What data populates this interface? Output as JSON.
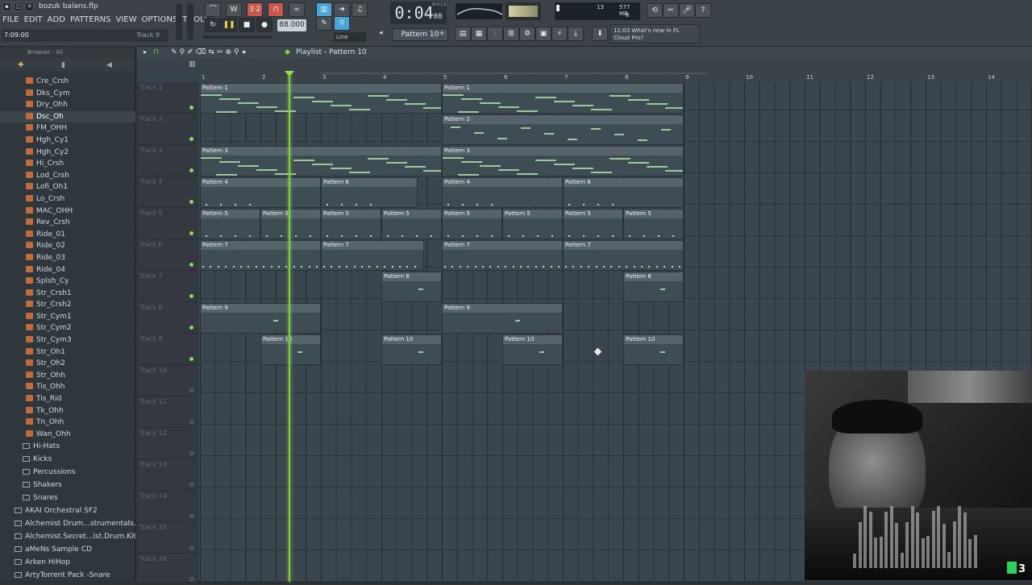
{
  "window": {
    "title": "bozuk balans.flp"
  },
  "menu": [
    "FILE",
    "EDIT",
    "ADD",
    "PATTERNS",
    "VIEW",
    "OPTIONS",
    "TOOLS",
    "?"
  ],
  "hint": {
    "time": "7:09:00",
    "track": "Track 9"
  },
  "transport": {
    "time_main": "0:04",
    "time_sub": "08",
    "time_unit": "M:S:CS",
    "tempo": "88.000",
    "pattern": "Pattern 10",
    "snap": "Line"
  },
  "cpu": {
    "cpu": "13",
    "mem": "577 MB",
    "voices": "8"
  },
  "news": {
    "time": "11:03",
    "text1": "What's new in FL",
    "text2": "Cloud Pro?"
  },
  "browser": {
    "header": "Browser - All",
    "items": [
      "Cre_Crsh",
      "Dks_Cym",
      "Dry_Ohh",
      "Dsc_Oh",
      "FM_OHH",
      "Hgh_Cy1",
      "Hgh_Cy2",
      "Hi_Crsh",
      "Lod_Crsh",
      "Lofi_Oh1",
      "Lo_Crsh",
      "MAC_OHH",
      "Rev_Crsh",
      "Ride_01",
      "Ride_02",
      "Ride_03",
      "Ride_04",
      "Splsh_Cy",
      "Str_Crsh1",
      "Str_Crsh2",
      "Str_Cym1",
      "Str_Cym2",
      "Str_Cym3",
      "Str_Oh1",
      "Str_Oh2",
      "Str_Ohh",
      "Tis_Ohh",
      "Tis_Rid",
      "Tk_Ohh",
      "Tn_Ohh",
      "Wan_Ohh"
    ],
    "selected": "Dsc_Oh",
    "folders": [
      "Hi-Hats",
      "Kicks",
      "Percussions",
      "Shakers",
      "Snares"
    ],
    "roots": [
      "AKAI Orchestral SF2",
      "Alchemist Drum...strumentals.com)",
      "Alchemist.Secret...ist.Drum.Kit).WAV",
      "aMeNs Sample CD",
      "Arken HiHop",
      "ArtyTorrent Pack -Snare"
    ]
  },
  "playlist": {
    "title": "Playlist - Pattern 10",
    "ruler": [
      "1",
      "2",
      "3",
      "4",
      "5",
      "6",
      "7",
      "8",
      "9",
      "10",
      "11",
      "12",
      "13",
      "14"
    ],
    "tracks": [
      "Track 1",
      "Track 2",
      "Track 3",
      "Track 4",
      "Track 5",
      "Track 6",
      "Track 7",
      "Track 8",
      "Track 9",
      "Track 10",
      "Track 11",
      "Track 12",
      "Track 13",
      "Track 14",
      "Track 15",
      "Track 16"
    ],
    "clips": [
      {
        "track": 0,
        "start": 1,
        "len": 4,
        "label": "Pattern 1",
        "kind": "lines"
      },
      {
        "track": 0,
        "start": 5,
        "len": 4,
        "label": "Pattern 1",
        "kind": "lines"
      },
      {
        "track": 1,
        "start": 5,
        "len": 4,
        "label": "Pattern 2",
        "kind": "sparse"
      },
      {
        "track": 2,
        "start": 1,
        "len": 4,
        "label": "Pattern 3",
        "kind": "lines"
      },
      {
        "track": 2,
        "start": 5,
        "len": 4,
        "label": "Pattern 3",
        "kind": "lines"
      },
      {
        "track": 3,
        "start": 1,
        "len": 2,
        "label": "Pattern 4",
        "kind": "dots"
      },
      {
        "track": 3,
        "start": 3,
        "len": 1.6,
        "label": "Pattern 6",
        "kind": "dots"
      },
      {
        "track": 3,
        "start": 5,
        "len": 2,
        "label": "Pattern 4",
        "kind": "dots"
      },
      {
        "track": 3,
        "start": 7,
        "len": 2,
        "label": "Pattern 6",
        "kind": "dots"
      },
      {
        "track": 4,
        "start": 1,
        "len": 1,
        "label": "Pattern 5",
        "kind": "dots"
      },
      {
        "track": 4,
        "start": 2,
        "len": 1,
        "label": "Pattern 5",
        "kind": "dots"
      },
      {
        "track": 4,
        "start": 3,
        "len": 1,
        "label": "Pattern 5",
        "kind": "dots"
      },
      {
        "track": 4,
        "start": 4,
        "len": 1,
        "label": "Pattern 5",
        "kind": "dots"
      },
      {
        "track": 4,
        "start": 5,
        "len": 1,
        "label": "Pattern 5",
        "kind": "dots"
      },
      {
        "track": 4,
        "start": 6,
        "len": 1,
        "label": "Pattern 5",
        "kind": "dots"
      },
      {
        "track": 4,
        "start": 7,
        "len": 1,
        "label": "Pattern 5",
        "kind": "dots"
      },
      {
        "track": 4,
        "start": 8,
        "len": 1,
        "label": "Pattern 5",
        "kind": "dots"
      },
      {
        "track": 5,
        "start": 1,
        "len": 2,
        "label": "Pattern 7",
        "kind": "row"
      },
      {
        "track": 5,
        "start": 3,
        "len": 1.7,
        "label": "Pattern 7",
        "kind": "row"
      },
      {
        "track": 5,
        "start": 5,
        "len": 2,
        "label": "Pattern 7",
        "kind": "row"
      },
      {
        "track": 5,
        "start": 7,
        "len": 2,
        "label": "Pattern 7",
        "kind": "row"
      },
      {
        "track": 6,
        "start": 4,
        "len": 1,
        "label": "Pattern 8",
        "kind": "one"
      },
      {
        "track": 6,
        "start": 8,
        "len": 1,
        "label": "Pattern 8",
        "kind": "one"
      },
      {
        "track": 7,
        "start": 1,
        "len": 2,
        "label": "Pattern 9",
        "kind": "one"
      },
      {
        "track": 7,
        "start": 5,
        "len": 2,
        "label": "Pattern 9",
        "kind": "one"
      },
      {
        "track": 8,
        "start": 2,
        "len": 1,
        "label": "Pattern 10",
        "kind": "one"
      },
      {
        "track": 8,
        "start": 4,
        "len": 1,
        "label": "Pattern 10",
        "kind": "one"
      },
      {
        "track": 8,
        "start": 6,
        "len": 1,
        "label": "Pattern 10",
        "kind": "one"
      },
      {
        "track": 8,
        "start": 8,
        "len": 1,
        "label": "Pattern 10",
        "kind": "one"
      }
    ]
  },
  "webcam": {
    "badge": "3"
  },
  "colors": {
    "accent": "#7fd13f",
    "clip": "#3f4c54",
    "header": "#56636b"
  }
}
